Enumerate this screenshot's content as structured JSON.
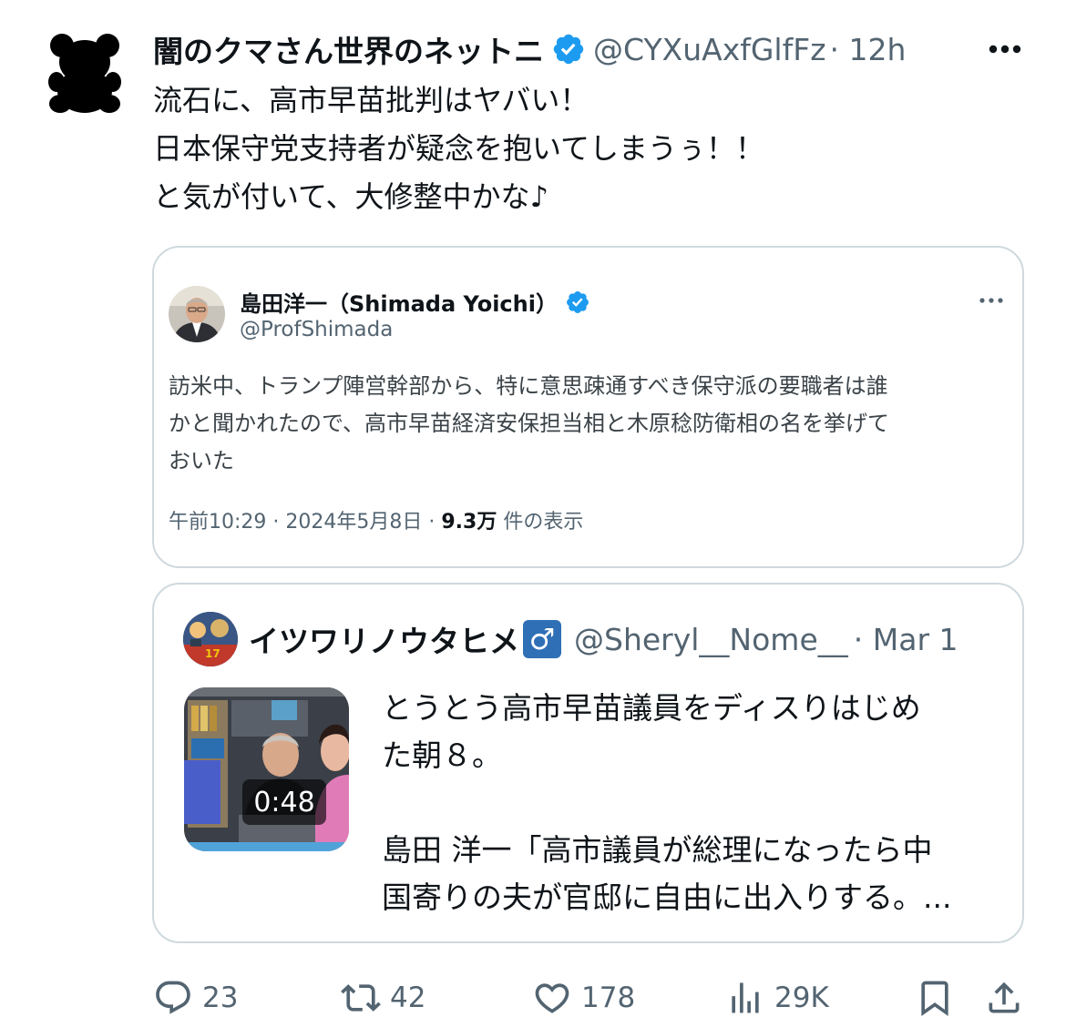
{
  "post": {
    "author_name": "闇のクマさん世界のネットニ",
    "handle": "@CYXuAxfGlfFz",
    "time": "· 12h",
    "more_icon": "more-horizontal-icon",
    "verified_icon": "verified-badge-icon",
    "text_lines": [
      "流石に、高市早苗批判はヤバい！",
      "日本保守党支持者が疑念を抱いてしまうぅ！！",
      "と気が付いて、大修整中かな♪"
    ]
  },
  "quote1": {
    "author_name": "島田洋一（Shimada Yoichi）",
    "handle": "@ProfShimada",
    "text_lines": [
      "訪米中、トランプ陣営幹部から、特に意思疎通すべき保守派の要職者は誰",
      "かと聞かれたので、高市早苗経済安保担当相と木原稔防衛相の名を挙げて",
      "おいた"
    ],
    "meta_prefix": "午前10:29 · 2024年5月8日 · ",
    "views_count": "9.3万",
    "views_suffix": " 件の表示"
  },
  "quote2": {
    "author_name": "イツワリノウタヒメ",
    "gender_icon": "♂",
    "handle": "@Sheryl__Nome__",
    "time": "· Mar 1",
    "video_duration": "0:48",
    "text_lines": [
      "とうとう高市早苗議員をディスりはじめ",
      "た朝８。",
      "",
      "島田 洋一「高市議員が総理になったら中",
      "国寄りの夫が官邸に自由に出入りする。..."
    ]
  },
  "actions": {
    "replies": "23",
    "reposts": "42",
    "likes": "178",
    "views": "29K"
  },
  "colors": {
    "text": "#0f1419",
    "muted": "#536471",
    "border": "#cfd9de",
    "verified": "#1d9bf0",
    "gender_badge": "#2f6fb5"
  }
}
